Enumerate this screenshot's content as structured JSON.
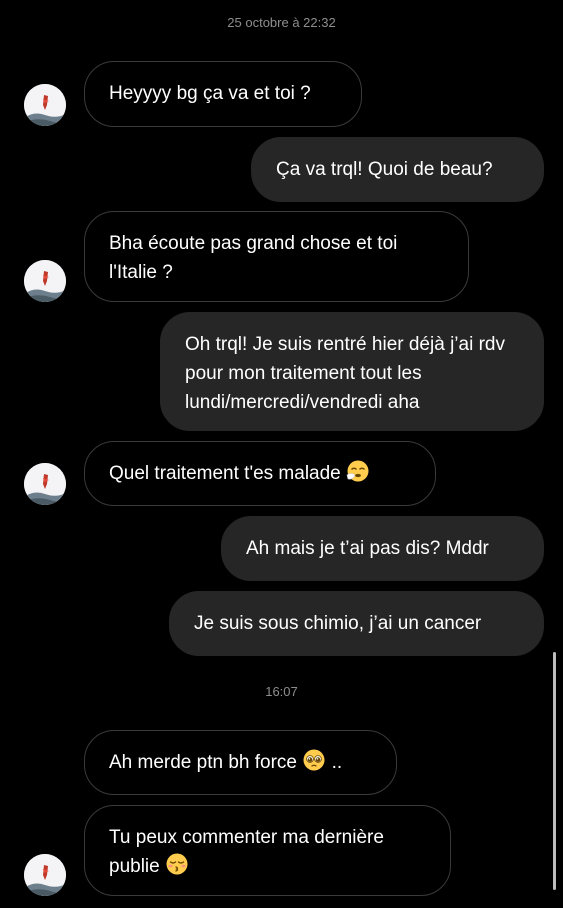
{
  "conversation": {
    "timestamps": [
      "25 octobre à 22:32",
      "16:07"
    ],
    "messages": [
      {
        "sender": "them",
        "text": "Heyyyy bg ça va et toi ?"
      },
      {
        "sender": "me",
        "text": "Ça va trql! Quoi de beau?"
      },
      {
        "sender": "them",
        "text": "Bha écoute pas grand chose et toi l'Italie ?"
      },
      {
        "sender": "me",
        "text": "Oh trql! Je suis rentré hier déjà j’ai rdv pour mon traitement tout les lundi/mercredi/vendredi aha"
      },
      {
        "sender": "them",
        "text": "Quel traitement t'es malade",
        "emoji": "sneezing-face-emoji"
      },
      {
        "sender": "me",
        "text": "Ah mais je t’ai pas dis? Mddr"
      },
      {
        "sender": "me",
        "text": "Je suis sous chimio, j’ai un cancer"
      },
      {
        "sender": "them",
        "text": "Ah merde ptn bh force",
        "emoji": "pleading-face-emoji",
        "suffix": ".."
      },
      {
        "sender": "them",
        "text": "Tu peux commenter ma dernière publie",
        "emoji": "kissing-face-emoji"
      }
    ]
  },
  "colors": {
    "background": "#000000",
    "outgoing_bubble": "#262626",
    "incoming_border": "#3a3a3a",
    "timestamp": "#8e8e8e",
    "text": "#ffffff"
  }
}
